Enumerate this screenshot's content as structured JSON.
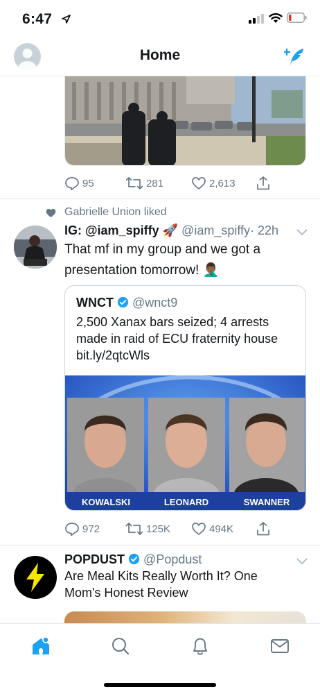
{
  "status_bar": {
    "time": "6:47"
  },
  "nav": {
    "title": "Home"
  },
  "tweet1": {
    "replies": "95",
    "retweets": "281",
    "likes": "2,613"
  },
  "tweet2": {
    "social_context": "Gabrielle Union liked",
    "name": "IG: @iam_spiffy",
    "name_emoji": "🚀",
    "handle": "@iam_spiffy",
    "time": "· 22h",
    "text": "That mf in my group and we got a presentation tomorrow! 🤦🏾‍♂️",
    "replies": "972",
    "retweets": "125K",
    "likes": "494K",
    "quote": {
      "name": "WNCT",
      "handle": "@wnct9",
      "text": "2,500 Xanax bars seized; 4 arrests made in raid of ECU fraternity house bit.ly/2qtcWls",
      "captions": [
        "KOWALSKI",
        "LEONARD",
        "SWANNER"
      ]
    }
  },
  "tweet3": {
    "name": "POPDUST",
    "handle": "@Popdust",
    "text": "Are Meal Kits Really Worth It? One Mom's Honest Review"
  },
  "colors": {
    "accent": "#1da1f2",
    "secondary_text": "#657786",
    "divider": "#e1e8ed",
    "verified": "#1da1f2"
  },
  "icons": {
    "reply": "reply-icon",
    "retweet": "retweet-icon",
    "like": "heart-icon",
    "share": "share-icon",
    "compose": "compose-tweet-icon",
    "tabs": [
      "home-icon",
      "search-icon",
      "notifications-bell-icon",
      "messages-envelope-icon"
    ]
  }
}
